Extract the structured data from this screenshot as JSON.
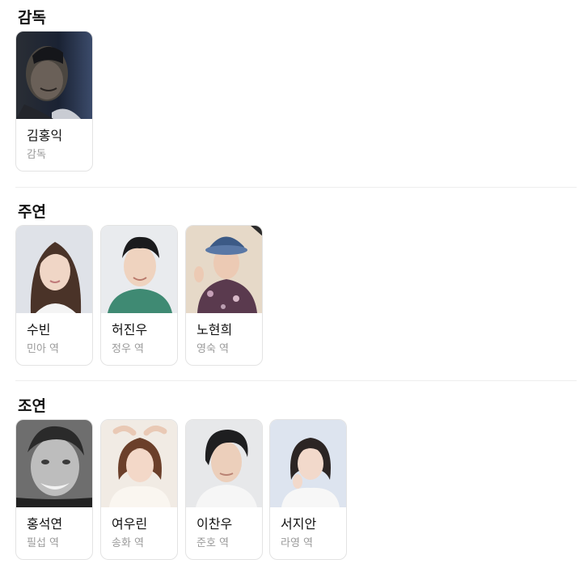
{
  "sections": [
    {
      "title": "감독",
      "people": [
        {
          "name": "김홍익",
          "role": "감독",
          "photo_icon": "director-portrait-photo"
        }
      ]
    },
    {
      "title": "주연",
      "people": [
        {
          "name": "수빈",
          "role": "민아 역",
          "photo_icon": "actress-portrait-photo"
        },
        {
          "name": "허진우",
          "role": "정우 역",
          "photo_icon": "actor-portrait-photo"
        },
        {
          "name": "노현희",
          "role": "영숙 역",
          "photo_icon": "actress-hat-portrait-photo"
        }
      ]
    },
    {
      "title": "조연",
      "people": [
        {
          "name": "홍석연",
          "role": "필섭 역",
          "photo_icon": "actor-bw-portrait-photo"
        },
        {
          "name": "여우린",
          "role": "송화 역",
          "photo_icon": "actress-portrait-photo"
        },
        {
          "name": "이찬우",
          "role": "준호 역",
          "photo_icon": "actor-portrait-photo"
        },
        {
          "name": "서지안",
          "role": "라영 역",
          "photo_icon": "actress-portrait-photo"
        }
      ]
    }
  ],
  "colors": {
    "card_border": "#e3e3e3",
    "divider": "#eeeeee",
    "role_text": "#9a9a9a",
    "title_text": "#111111"
  }
}
